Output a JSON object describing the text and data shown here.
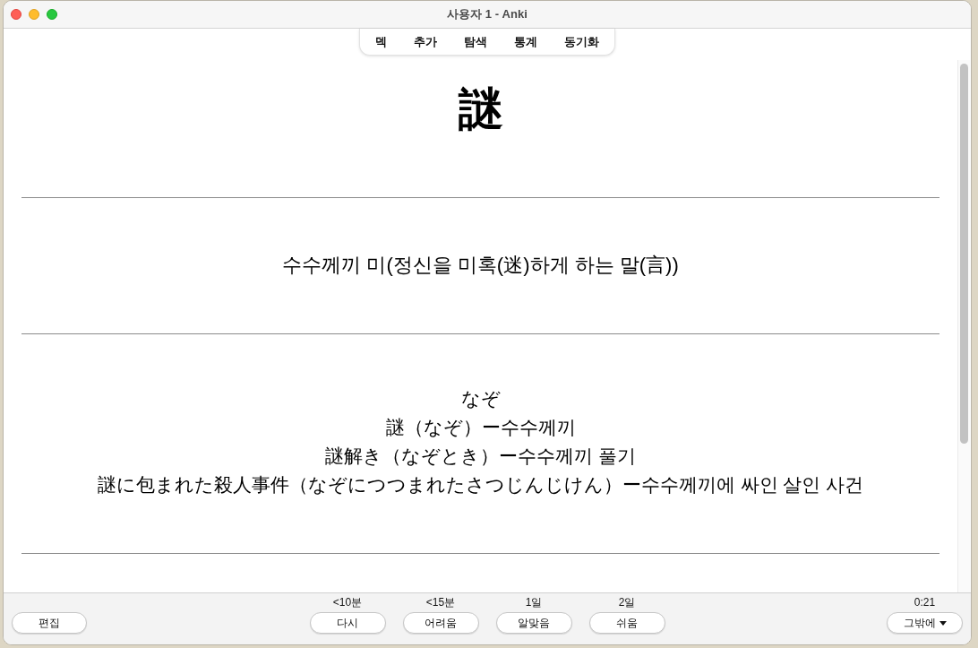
{
  "window": {
    "title": "사용자 1 - Anki"
  },
  "toolbar": [
    "덱",
    "추가",
    "탐색",
    "통계",
    "동기화"
  ],
  "card": {
    "front": "謎",
    "meaning": "수수께끼 미(정신을 미혹(迷)하게 하는 말(言))",
    "readings": [
      "なぞ",
      "謎（なぞ）ー수수께끼",
      "謎解き（なぞとき）ー수수께끼 풀기",
      "謎に包まれた殺人事件（なぞにつつまれたさつじんじけん）ー수수께끼에 싸인 살인 사건"
    ]
  },
  "bottom_bar": {
    "edit_button": "편집",
    "answers": [
      {
        "interval": "<10분",
        "label": "다시"
      },
      {
        "interval": "<15분",
        "label": "어려움"
      },
      {
        "interval": "1일",
        "label": "알맞음"
      },
      {
        "interval": "2일",
        "label": "쉬움"
      }
    ],
    "timer": "0:21",
    "more_button": "그밖에"
  }
}
